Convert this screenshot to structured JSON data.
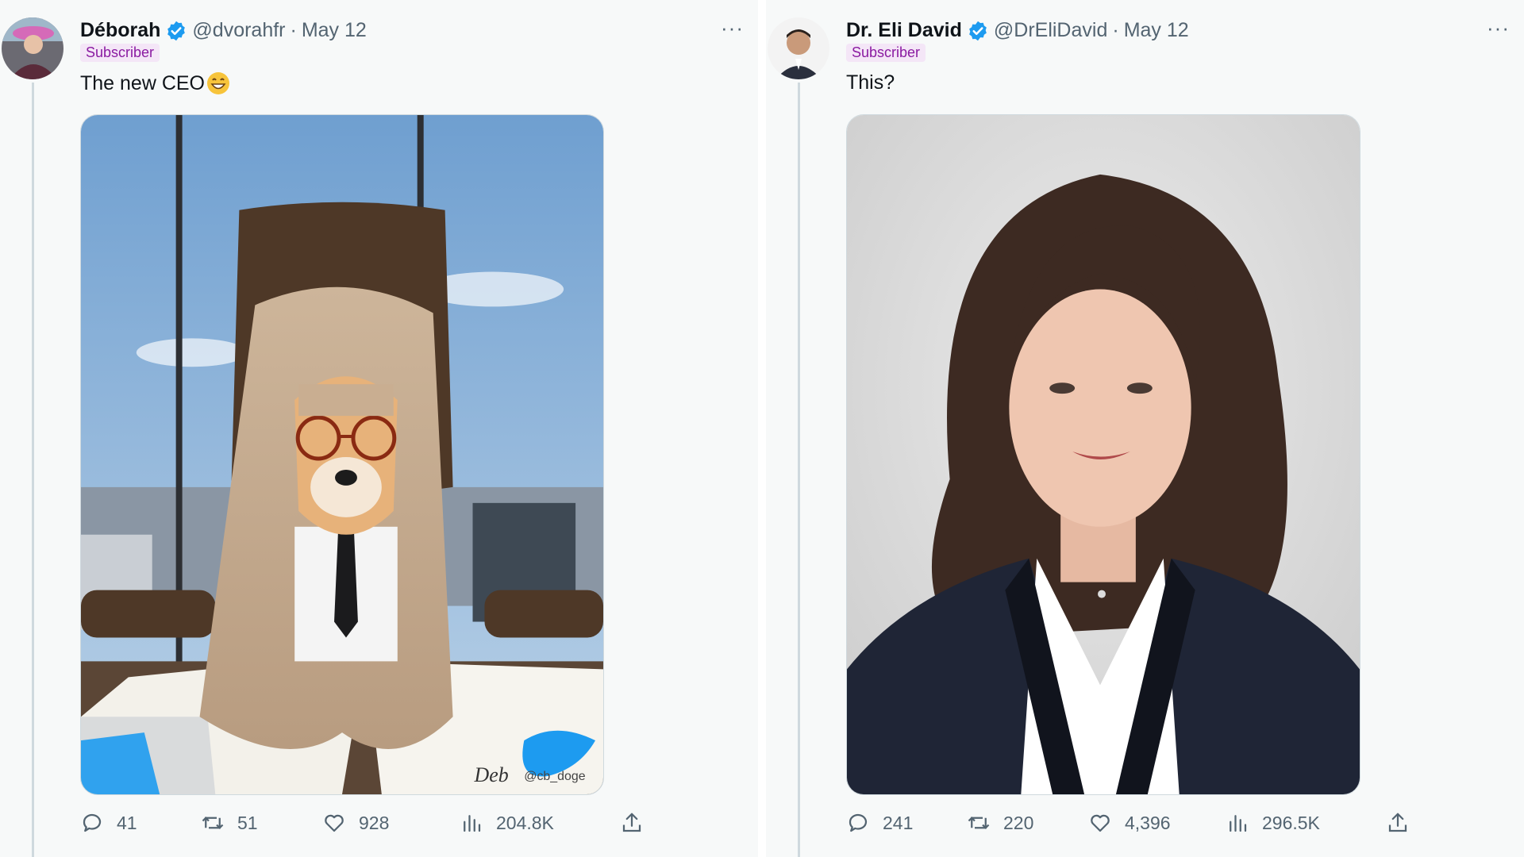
{
  "tweets": [
    {
      "author_name": "Déborah",
      "handle": "@dvorahfr",
      "separator": "·",
      "date": "May 12",
      "badge": "Subscriber",
      "text": "The new CEO",
      "emoji": "grinning-face-emoji",
      "image_watermark": "Deb",
      "image_credit": "@cb_doge",
      "stats": {
        "replies": "41",
        "retweets": "51",
        "likes": "928",
        "views": "204.8K"
      }
    },
    {
      "author_name": "Dr. Eli David",
      "handle": "@DrEliDavid",
      "separator": "·",
      "date": "May 12",
      "badge": "Subscriber",
      "text": "This?",
      "stats": {
        "replies": "241",
        "retweets": "220",
        "likes": "4,396",
        "views": "296.5K"
      }
    }
  ],
  "more_label": "···",
  "colors": {
    "verified": "#1d9bf0",
    "subscriber_bg": "#f4e6f7",
    "subscriber_text": "#8a1aa1",
    "muted": "#536471"
  },
  "icons": [
    "reply-icon",
    "retweet-icon",
    "like-icon",
    "views-icon",
    "share-icon",
    "more-icon",
    "verified-badge-icon"
  ]
}
